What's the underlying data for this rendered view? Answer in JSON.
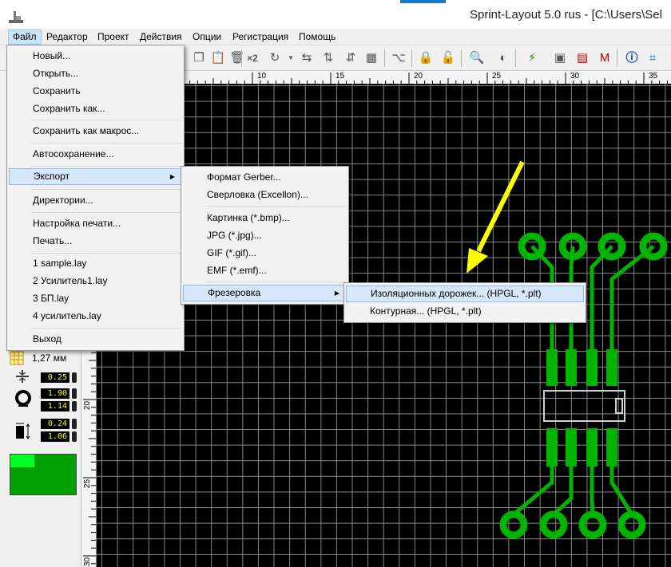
{
  "window": {
    "title": "Sprint-Layout 5.0 rus    - [C:\\Users\\Sel"
  },
  "menubar": [
    "Файл",
    "Редактор",
    "Проект",
    "Действия",
    "Опции",
    "Регистрация",
    "Помощь"
  ],
  "ruler": {
    "top_labels": [
      "10",
      "15",
      "20",
      "25",
      "30",
      "35"
    ],
    "left_labels": [
      "20",
      "25",
      "30"
    ]
  },
  "left_panel": {
    "grid_label": "1,27 мм",
    "track_width": "0.25",
    "pad_outer": "1.90",
    "pad_inner": "1.14",
    "smd_w": "0.24",
    "smd_h": "1.06"
  },
  "file_menu": {
    "items": [
      "Новый...",
      "Открыть...",
      "Сохранить",
      "Сохранить как...",
      "Сохранить как макрос...",
      "Автосохранение...",
      "Экспорт",
      "Директории...",
      "Настройка печати...",
      "Печать...",
      "1 sample.lay",
      "2 Усилитель1.lay",
      "3 БП.lay",
      "4 усилитель.lay",
      "Выход"
    ]
  },
  "export_menu": {
    "items": [
      "Формат Gerber...",
      "Сверловка (Excellon)...",
      "Картинка (*.bmp)...",
      "JPG (*.jpg)...",
      "GIF (*.gif)...",
      "EMF (*.emf)...",
      "Фрезеровка"
    ]
  },
  "milling_menu": {
    "items": [
      "Изоляционных дорожек... (HPGL, *.plt)",
      "Контурная... (HPGL, *.plt)"
    ]
  },
  "colors": {
    "copper": "#00b400",
    "annotation_arrow": "#ffff00",
    "highlight": "#d5e7f8"
  }
}
